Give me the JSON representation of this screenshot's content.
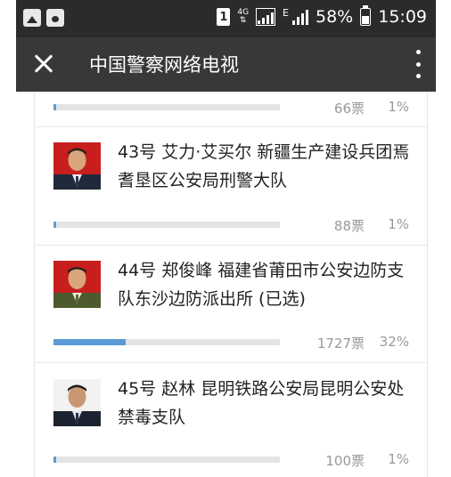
{
  "status_bar": {
    "network": "4G",
    "battery": "58%",
    "time": "15:09",
    "sim_badge": "1",
    "net_letter": "E",
    "icons": [
      "gallery-icon",
      "paw-icon",
      "signal-icon",
      "battery-icon"
    ]
  },
  "app_bar": {
    "title": "中国警察网络电视",
    "close_icon": "close-icon",
    "more_icon": "more-vert-icon"
  },
  "colors": {
    "status_bar": "#2b2b2b",
    "app_bar": "#383838",
    "bar_track": "#e4e4e4",
    "bar_fill": "#5b9bd5",
    "meta_text": "#999999"
  },
  "rows": {
    "prev": {
      "votes": "66票",
      "percent": "1%",
      "fill": 0.01
    },
    "c43": {
      "name": "43号 艾力·艾买尔 新疆生产建设兵团焉耆垦区公安局刑警大队",
      "votes": "88票",
      "percent": "1%",
      "fill": 0.01
    },
    "c44": {
      "name": "44号 郑俊峰 福建省莆田市公安边防支队东沙边防派出所 (已选)",
      "votes": "1727票",
      "percent": "32%",
      "fill": 0.32
    },
    "c45": {
      "name": "45号 赵林 昆明铁路公安局昆明公安处禁毒支队",
      "votes": "100票",
      "percent": "1%",
      "fill": 0.01
    }
  }
}
